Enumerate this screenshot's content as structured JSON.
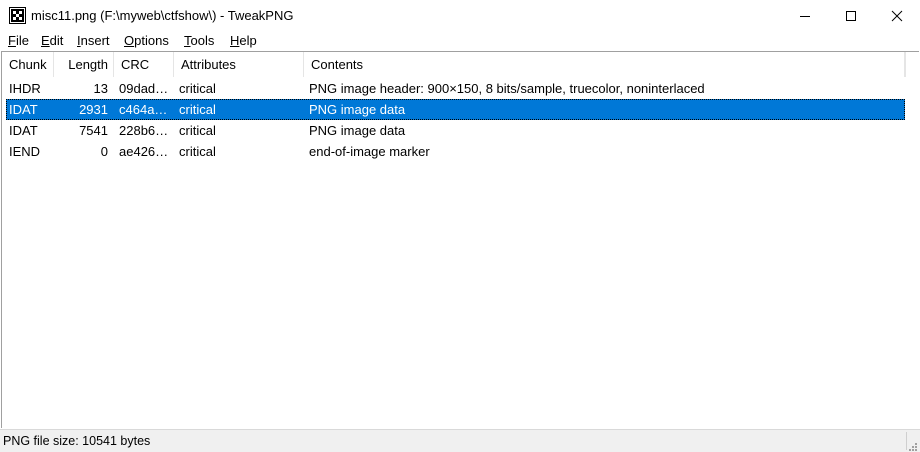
{
  "window": {
    "title": "misc11.png (F:\\myweb\\ctfshow\\) - TweakPNG",
    "app_icon": "tweakpng-icon",
    "controls": [
      "minimize-icon",
      "maximize-icon",
      "close-icon"
    ]
  },
  "menu": {
    "file": {
      "mnemonic": "F",
      "rest": "ile"
    },
    "edit": {
      "mnemonic": "E",
      "rest": "dit"
    },
    "insert": {
      "mnemonic": "I",
      "rest": "nsert"
    },
    "options": {
      "mnemonic": "O",
      "rest": "ptions"
    },
    "tools": {
      "mnemonic": "T",
      "rest": "ools"
    },
    "help": {
      "mnemonic": "H",
      "rest": "elp"
    }
  },
  "table": {
    "headers": {
      "chunk": "Chunk",
      "length": "Length",
      "crc": "CRC",
      "attributes": "Attributes",
      "contents": "Contents"
    },
    "selected_row": 1,
    "selection_color": "#0078d7",
    "rows": [
      {
        "chunk": "IHDR",
        "length": "13",
        "crc": "09dad…",
        "attributes": "critical",
        "contents": "PNG image header: 900×150, 8 bits/sample, truecolor, noninterlaced"
      },
      {
        "chunk": "IDAT",
        "length": "2931",
        "crc": "c464a…",
        "attributes": "critical",
        "contents": "PNG image data"
      },
      {
        "chunk": "IDAT",
        "length": "7541",
        "crc": "228b6…",
        "attributes": "critical",
        "contents": "PNG image data"
      },
      {
        "chunk": "IEND",
        "length": "0",
        "crc": "ae426…",
        "attributes": "critical",
        "contents": "end-of-image marker"
      }
    ]
  },
  "status": {
    "text": "PNG file size: 10541 bytes"
  }
}
